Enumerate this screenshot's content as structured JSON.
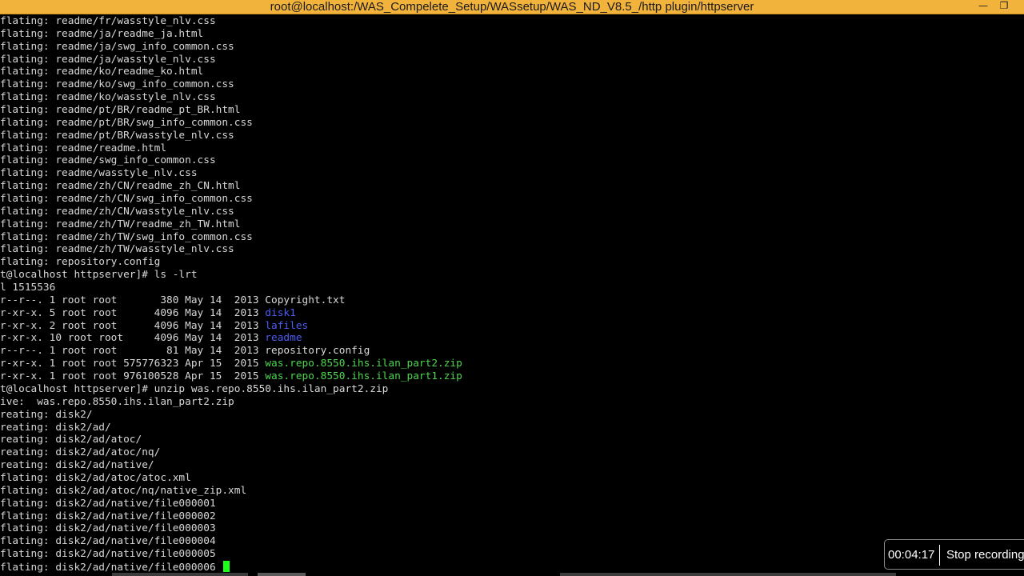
{
  "window": {
    "title": "root@localhost:/WAS_Compelete_Setup/WASsetup/WAS_ND_V8.5_/http plugin/httpserver",
    "minimize_glyph": "—",
    "restore_glyph": "❐"
  },
  "terminal": {
    "lines": [
      {
        "text": "flating: readme/fr/wasstyle_nlv.css"
      },
      {
        "text": "flating: readme/ja/readme_ja.html"
      },
      {
        "text": "flating: readme/ja/swg_info_common.css"
      },
      {
        "text": "flating: readme/ja/wasstyle_nlv.css"
      },
      {
        "text": "flating: readme/ko/readme_ko.html"
      },
      {
        "text": "flating: readme/ko/swg_info_common.css"
      },
      {
        "text": "flating: readme/ko/wasstyle_nlv.css"
      },
      {
        "text": "flating: readme/pt/BR/readme_pt_BR.html"
      },
      {
        "text": "flating: readme/pt/BR/swg_info_common.css"
      },
      {
        "text": "flating: readme/pt/BR/wasstyle_nlv.css"
      },
      {
        "text": "flating: readme/readme.html"
      },
      {
        "text": "flating: readme/swg_info_common.css"
      },
      {
        "text": "flating: readme/wasstyle_nlv.css"
      },
      {
        "text": "flating: readme/zh/CN/readme_zh_CN.html"
      },
      {
        "text": "flating: readme/zh/CN/swg_info_common.css"
      },
      {
        "text": "flating: readme/zh/CN/wasstyle_nlv.css"
      },
      {
        "text": "flating: readme/zh/TW/readme_zh_TW.html"
      },
      {
        "text": "flating: readme/zh/TW/swg_info_common.css"
      },
      {
        "text": "flating: readme/zh/TW/wasstyle_nlv.css"
      },
      {
        "text": "flating: repository.config"
      },
      {
        "text": "t@localhost httpserver]# ls -lrt"
      },
      {
        "text": "l 1515536"
      },
      {
        "text": "r--r--. 1 root root       380 May 14  2013 ",
        "name": "Copyright.txt",
        "color": "default"
      },
      {
        "text": "r-xr-x. 5 root root      4096 May 14  2013 ",
        "name": "disk1",
        "color": "blue"
      },
      {
        "text": "r-xr-x. 2 root root      4096 May 14  2013 ",
        "name": "lafiles",
        "color": "blue"
      },
      {
        "text": "r-xr-x. 10 root root     4096 May 14  2013 ",
        "name": "readme",
        "color": "blue"
      },
      {
        "text": "r--r--. 1 root root        81 May 14  2013 ",
        "name": "repository.config",
        "color": "default"
      },
      {
        "text": "r-xr-x. 1 root root 575776323 Apr 15  2015 ",
        "name": "was.repo.8550.ihs.ilan_part2.zip",
        "color": "green"
      },
      {
        "text": "r-xr-x. 1 root root 976100528 Apr 15  2015 ",
        "name": "was.repo.8550.ihs.ilan_part1.zip",
        "color": "green"
      },
      {
        "text": "t@localhost httpserver]# unzip was.repo.8550.ihs.ilan_part2.zip"
      },
      {
        "text": "ive:  was.repo.8550.ihs.ilan_part2.zip"
      },
      {
        "text": "reating: disk2/"
      },
      {
        "text": "reating: disk2/ad/"
      },
      {
        "text": "reating: disk2/ad/atoc/"
      },
      {
        "text": "reating: disk2/ad/atoc/nq/"
      },
      {
        "text": "reating: disk2/ad/native/"
      },
      {
        "text": "flating: disk2/ad/atoc/atoc.xml"
      },
      {
        "text": "flating: disk2/ad/atoc/nq/native_zip.xml"
      },
      {
        "text": "flating: disk2/ad/native/file000001"
      },
      {
        "text": "flating: disk2/ad/native/file000002"
      },
      {
        "text": "flating: disk2/ad/native/file000003"
      },
      {
        "text": "flating: disk2/ad/native/file000004"
      },
      {
        "text": "flating: disk2/ad/native/file000005"
      },
      {
        "text": "flating: disk2/ad/native/file000006 ",
        "cursor": true
      }
    ],
    "colors": {
      "default": "#d8d8d8",
      "blue": "#4d5cf2",
      "green": "#4ed64e",
      "cursor": "#1aff1a",
      "titlebar": "#f2b33d"
    }
  },
  "recording": {
    "elapsed": "00:04:17",
    "stop_label": "Stop recording"
  }
}
